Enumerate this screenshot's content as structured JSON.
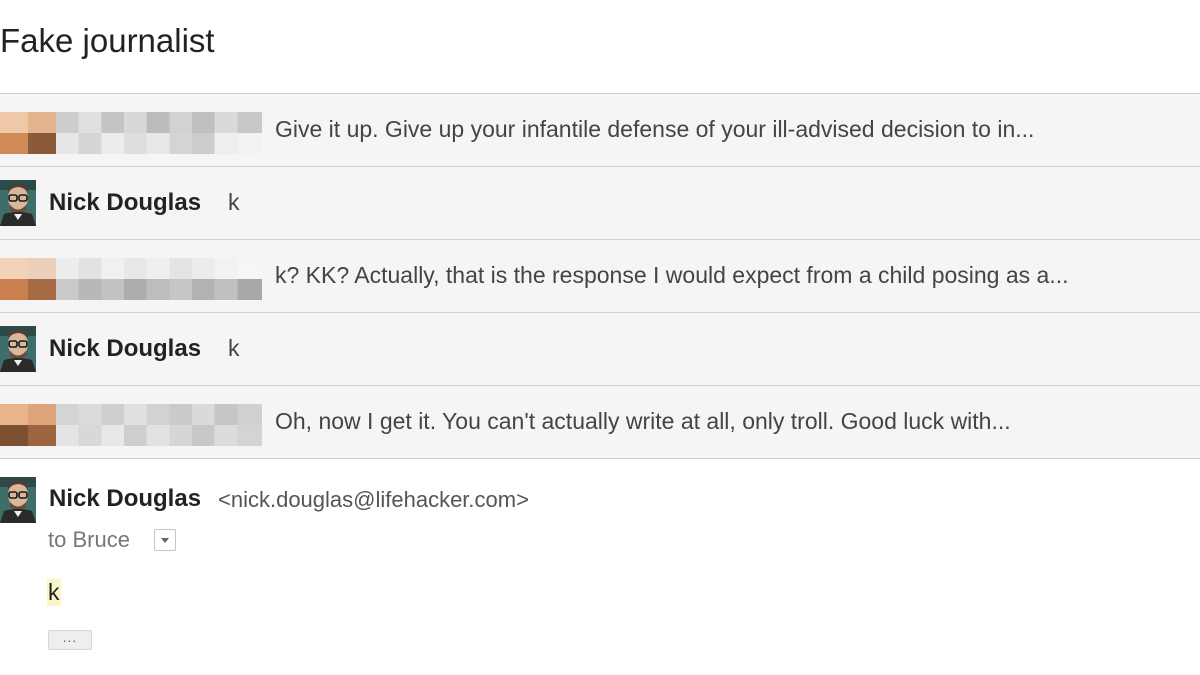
{
  "subject": "Fake journalist",
  "messages": [
    {
      "type": "collapsed-redacted",
      "snippet": "Give it up. Give up your infantile defense of your ill-advised decision to in..."
    },
    {
      "type": "collapsed",
      "sender": "Nick Douglas",
      "snippet": "k"
    },
    {
      "type": "collapsed-redacted",
      "snippet": "k? KK? Actually, that is the response I would expect from a child posing as a..."
    },
    {
      "type": "collapsed",
      "sender": "Nick Douglas",
      "snippet": "k"
    },
    {
      "type": "collapsed-redacted",
      "snippet": "Oh, now I get it. You can't actually write at all, only troll. Good luck with..."
    }
  ],
  "expanded": {
    "sender": "Nick Douglas",
    "email": "<nick.douglas@lifehacker.com>",
    "to_line": "to Bruce",
    "body": "k",
    "show_trimmed_label": "..."
  },
  "icons": {
    "avatar": "avatar-photo-icon",
    "dropdown": "chevron-down-icon"
  },
  "colors": {
    "collapsed_bg": "#f5f5f5",
    "divider": "#cfcfcf",
    "highlight": "#fbf6c8"
  }
}
